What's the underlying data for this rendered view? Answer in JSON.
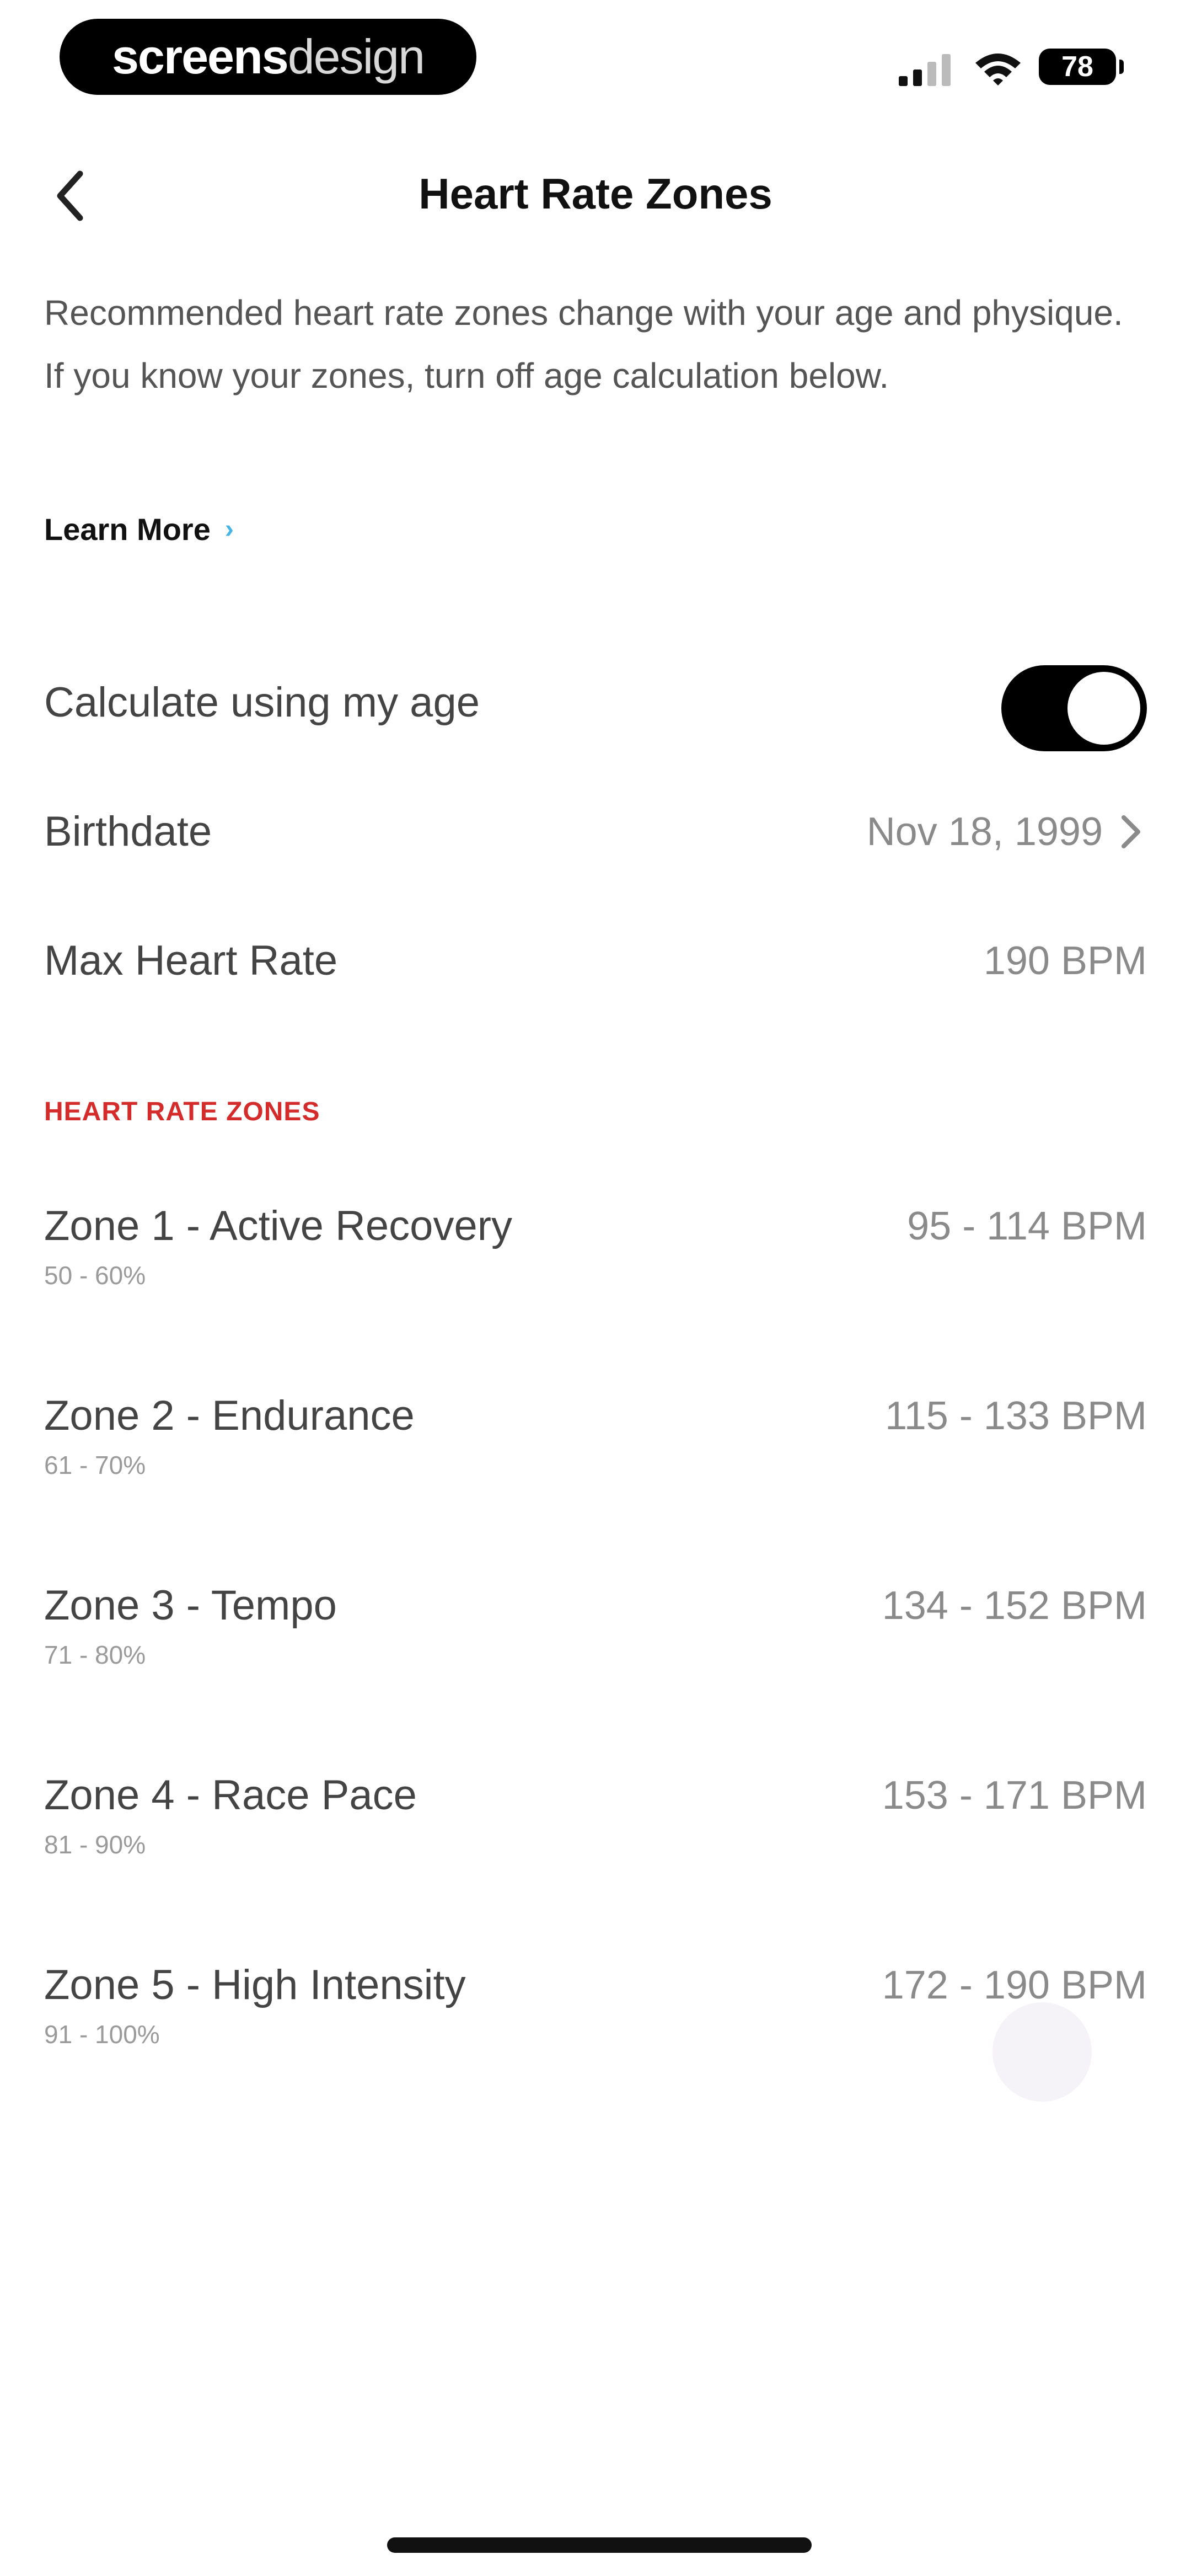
{
  "status_bar": {
    "brand_bold": "screens",
    "brand_light": "design",
    "battery": "78"
  },
  "header": {
    "title": "Heart Rate Zones"
  },
  "description": "Recommended heart rate zones change with your age and physique. If you know your zones, turn off age calculation below.",
  "learn_more": {
    "label": "Learn More"
  },
  "settings": {
    "calc_age_label": "Calculate using my age",
    "calc_age_enabled": true,
    "birthdate_label": "Birthdate",
    "birthdate_value": "Nov 18, 1999",
    "max_hr_label": "Max Heart Rate",
    "max_hr_value": "190 BPM"
  },
  "zones_section": {
    "title": "HEART RATE ZONES",
    "zones": [
      {
        "name": "Zone 1 - Active Recovery",
        "percent": "50 - 60%",
        "bpm": "95 - 114 BPM"
      },
      {
        "name": "Zone 2 - Endurance",
        "percent": "61 - 70%",
        "bpm": "115 - 133 BPM"
      },
      {
        "name": "Zone 3 - Tempo",
        "percent": "71 - 80%",
        "bpm": "134 - 152 BPM"
      },
      {
        "name": "Zone 4 - Race Pace",
        "percent": "81 - 90%",
        "bpm": "153 - 171 BPM"
      },
      {
        "name": "Zone 5 - High Intensity",
        "percent": "91 - 100%",
        "bpm": "172 - 190 BPM"
      }
    ]
  },
  "colors": {
    "accent_red": "#d42b2b",
    "link_blue": "#45b4e6",
    "toggle_on": "#000000"
  },
  "icons": {
    "back": "chevron-left-icon",
    "learn_more": "chevron-right-icon",
    "birthdate": "chevron-right-icon",
    "signal": "cellular-signal-icon",
    "wifi": "wifi-icon",
    "battery": "battery-icon"
  }
}
